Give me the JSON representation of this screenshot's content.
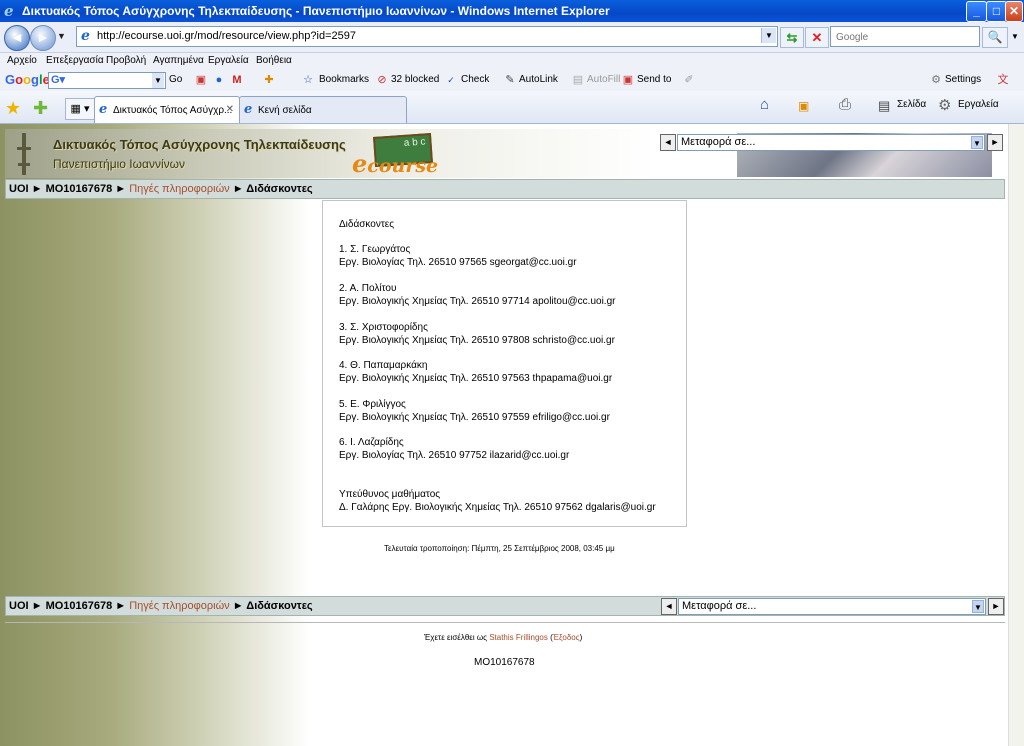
{
  "window": {
    "title": "Δικτυακός Τόπος Ασύγχρονης Τηλεκπαίδευσης - Πανεπιστήμιο Ιωαννίνων - Windows Internet Explorer",
    "minimize": "_",
    "maximize": "□",
    "close": "✕"
  },
  "address_bar": {
    "url": "http://ecourse.uoi.gr/mod/resource/view.php?id=2597",
    "search_placeholder": "Google"
  },
  "menu": [
    "Αρχείο",
    "Επεξεργασία",
    "Προβολή",
    "Αγαπημένα",
    "Εργαλεία",
    "Βοήθεια"
  ],
  "google_toolbar": {
    "logo": "Google",
    "go": "Go",
    "bookmarks": "Bookmarks",
    "blocked": "32 blocked",
    "check": "Check",
    "autolink": "AutoLink",
    "autofill": "AutoFill",
    "sendto": "Send to",
    "settings": "Settings"
  },
  "tabs": [
    {
      "label": "Δικτυακός Τόπος Ασύγχρ...",
      "active": true
    },
    {
      "label": "Κενή σελίδα",
      "active": false
    }
  ],
  "command_bar": {
    "page": "Σελίδα",
    "tools": "Εργαλεία"
  },
  "site": {
    "title": "Δικτυακός Τόπος Ασύγχρονης Τηλεκπαίδευσης",
    "subtitle": "Πανεπιστήμιο Ιωαννίνων",
    "logo_main": "course",
    "logo_e": "e",
    "logo_chalk": "a b c"
  },
  "jump_menu": {
    "prev": "◄",
    "next": "►",
    "label": "Μεταφορά σε..."
  },
  "breadcrumb": {
    "home": "UOI",
    "sep": " ► ",
    "course": "MO10167678",
    "section": "Πηγές πληροφοριών",
    "current": "Διδάσκοντες"
  },
  "content": {
    "heading": "Διδάσκοντες",
    "entries": [
      {
        "name": "1. Σ. Γεωργάτος",
        "details": "Εργ. Βιολογίας Τηλ. 26510 97565 sgeorgat@cc.uoi.gr"
      },
      {
        "name": "2. Α. Πολίτου",
        "details": "Εργ. Βιολογικής Χημείας Τηλ. 26510 97714 apolitou@cc.uoi.gr"
      },
      {
        "name": "3. Σ. Χριστοφορίδης",
        "details": "Εργ. Βιολογικής Χημείας Τηλ. 26510 97808 schristo@cc.uoi.gr"
      },
      {
        "name": "4. Θ. Παπαμαρκάκη",
        "details": "Εργ. Βιολογικής Χημείας Τηλ. 26510 97563 thpapama@uoi.gr"
      },
      {
        "name": "5. Ε. Φριλίγγος",
        "details": "Εργ. Βιολογικής Χημείας Τηλ. 26510 97559 efriligo@cc.uoi.gr"
      },
      {
        "name": "6. Ι. Λαζαρίδης",
        "details": "Εργ. Βιολογίας Τηλ. 26510 97752 ilazarid@cc.uoi.gr"
      }
    ],
    "responsible_label": "Υπεύθυνος μαθήματος",
    "responsible": "Δ. Γαλάρης Εργ. Βιολογικής Χημείας Τηλ. 26510 97562 dgalaris@uoi.gr"
  },
  "modified": "Τελευταία τροποποίηση: Πέμπτη, 25 Σεπτέμβριος 2008, 03:45 μμ",
  "footer": {
    "logged_in_prefix": "Έχετε εισέλθει ως ",
    "user": "Stathis Frillingos",
    "logout": "Έξοδος",
    "course_code": "MO10167678"
  }
}
